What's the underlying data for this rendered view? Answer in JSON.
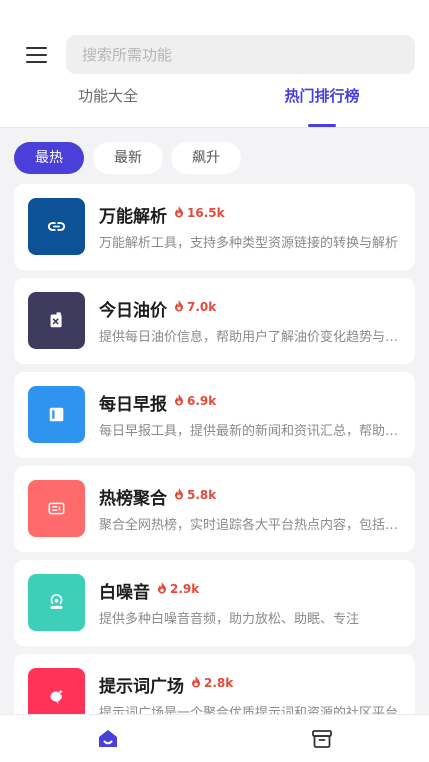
{
  "search": {
    "placeholder": "搜索所需功能"
  },
  "tabs": [
    {
      "label": "功能大全",
      "active": false
    },
    {
      "label": "热门排行榜",
      "active": true
    }
  ],
  "filters": [
    {
      "label": "最热",
      "active": true
    },
    {
      "label": "最新",
      "active": false
    },
    {
      "label": "飙升",
      "active": false
    }
  ],
  "colors": {
    "accent": "#4a3fd8",
    "hot": "#e24b3b"
  },
  "items": [
    {
      "title": "万能解析",
      "hot": "16.5k",
      "desc": "万能解析工具，支持多种类型资源链接的转换与解析",
      "icon": "link-icon",
      "color": "#0d5296"
    },
    {
      "title": "今日油价",
      "hot": "7.0k",
      "desc": "提供每日油价信息，帮助用户了解油价变化趋势与各地价格",
      "icon": "fuel-icon",
      "color": "#3d3a5e"
    },
    {
      "title": "每日早报",
      "hot": "6.9k",
      "desc": "每日早报工具，提供最新的新闻和资讯汇总，帮助用户快速了解",
      "icon": "newspaper-icon",
      "color": "#2f93f0"
    },
    {
      "title": "热榜聚合",
      "hot": "5.8k",
      "desc": "聚合全网热榜，实时追踪各大平台热点内容，包括微博知乎等",
      "icon": "list-icon",
      "color": "#ff6b6b"
    },
    {
      "title": "白噪音",
      "hot": "2.9k",
      "desc": "提供多种白噪音音频，助力放松、助眠、专注",
      "icon": "sound-icon",
      "color": "#3ecfb8"
    },
    {
      "title": "提示词广场",
      "hot": "2.8k",
      "desc": "提示词广场是一个聚合优质提示词和资源的社区平台",
      "icon": "sparkle-icon",
      "color": "#ff3358"
    }
  ],
  "bottom_nav": [
    {
      "icon": "home-icon",
      "active": true
    },
    {
      "icon": "archive-icon",
      "active": false
    }
  ]
}
